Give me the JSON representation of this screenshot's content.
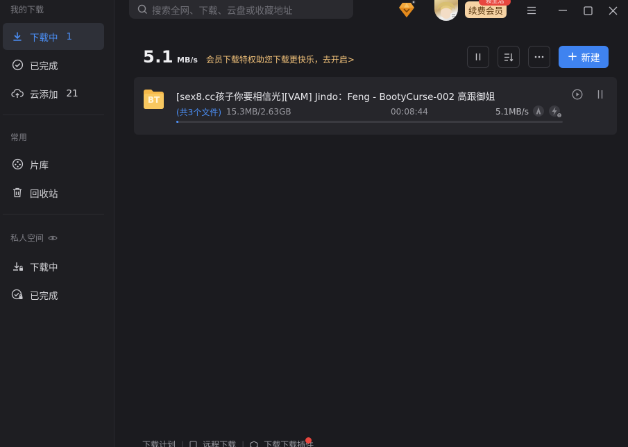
{
  "sidebar": {
    "section_my_downloads": "我的下载",
    "items": [
      {
        "label": "下载中",
        "count": "1"
      },
      {
        "label": "已完成",
        "count": ""
      },
      {
        "label": "云添加",
        "count": "21"
      }
    ],
    "section_common": "常用",
    "common_items": [
      {
        "label": "片库"
      },
      {
        "label": "回收站"
      }
    ],
    "section_private": "私人空间",
    "private_items": [
      {
        "label": "下载中"
      },
      {
        "label": "已完成"
      }
    ]
  },
  "search": {
    "placeholder": "搜索全网、下载、云盘或收藏地址"
  },
  "account": {
    "vip_button": "续费会员",
    "vip_badge": "领生活"
  },
  "header": {
    "speed_value": "5.1",
    "speed_unit": "MB/s",
    "promo_text": "会员下载特权助您下载更快乐，去开启>",
    "new_button": "新建"
  },
  "task": {
    "icon_text": "BT",
    "name": "[sex8.cc孩子你要相信光][VAM] Jindo：Feng - BootyCurse-002 高跟御姐",
    "files": "(共3个文件)",
    "size": "15.3MB/2.63GB",
    "time_left": "00:08:44",
    "rate": "5.1MB/s",
    "progress": 0.006
  },
  "footer": {
    "plan": "下载计划",
    "remote": "远程下载",
    "plugin": "下载下载插件"
  },
  "colors": {
    "accent": "#3f83f0",
    "promo": "#f2c27a",
    "vip": "#f6d3a4",
    "badge": "#e8463e"
  }
}
